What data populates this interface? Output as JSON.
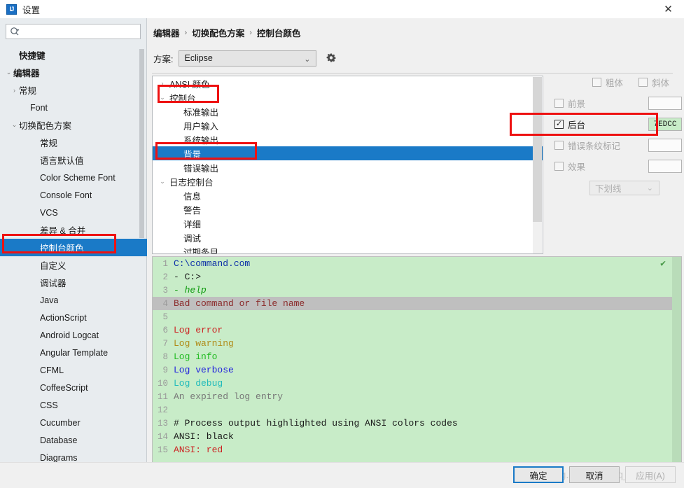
{
  "window": {
    "title": "设置",
    "app_icon_text": "IJ",
    "close_icon": "close-icon",
    "close_glyph": "✕"
  },
  "search": {
    "placeholder": "",
    "value": "",
    "icon": "search-icon"
  },
  "sidebar": {
    "items": [
      {
        "label": "快捷键",
        "indent": 1,
        "twist": "",
        "bold": true,
        "selected": false
      },
      {
        "label": "编辑器",
        "indent": 0,
        "twist": "⌄",
        "bold": true,
        "selected": false
      },
      {
        "label": "常规",
        "indent": 1,
        "twist": "›",
        "bold": false,
        "selected": false
      },
      {
        "label": "Font",
        "indent": 2,
        "twist": "",
        "bold": false,
        "selected": false
      },
      {
        "label": "切换配色方案",
        "indent": 1,
        "twist": "⌄",
        "bold": false,
        "selected": false
      },
      {
        "label": "常规",
        "indent": 3,
        "twist": "",
        "bold": false,
        "selected": false
      },
      {
        "label": "语言默认值",
        "indent": 3,
        "twist": "",
        "bold": false,
        "selected": false
      },
      {
        "label": "Color Scheme Font",
        "indent": 3,
        "twist": "",
        "bold": false,
        "selected": false
      },
      {
        "label": "Console Font",
        "indent": 3,
        "twist": "",
        "bold": false,
        "selected": false
      },
      {
        "label": "VCS",
        "indent": 3,
        "twist": "",
        "bold": false,
        "selected": false
      },
      {
        "label": "差异 & 合并",
        "indent": 3,
        "twist": "",
        "bold": false,
        "selected": false
      },
      {
        "label": "控制台颜色",
        "indent": 3,
        "twist": "",
        "bold": false,
        "selected": true
      },
      {
        "label": "自定义",
        "indent": 3,
        "twist": "",
        "bold": false,
        "selected": false
      },
      {
        "label": "调试器",
        "indent": 3,
        "twist": "",
        "bold": false,
        "selected": false
      },
      {
        "label": "Java",
        "indent": 3,
        "twist": "",
        "bold": false,
        "selected": false
      },
      {
        "label": "ActionScript",
        "indent": 3,
        "twist": "",
        "bold": false,
        "selected": false
      },
      {
        "label": "Android Logcat",
        "indent": 3,
        "twist": "",
        "bold": false,
        "selected": false
      },
      {
        "label": "Angular Template",
        "indent": 3,
        "twist": "",
        "bold": false,
        "selected": false
      },
      {
        "label": "CFML",
        "indent": 3,
        "twist": "",
        "bold": false,
        "selected": false
      },
      {
        "label": "CoffeeScript",
        "indent": 3,
        "twist": "",
        "bold": false,
        "selected": false
      },
      {
        "label": "CSS",
        "indent": 3,
        "twist": "",
        "bold": false,
        "selected": false
      },
      {
        "label": "Cucumber",
        "indent": 3,
        "twist": "",
        "bold": false,
        "selected": false
      },
      {
        "label": "Database",
        "indent": 3,
        "twist": "",
        "bold": false,
        "selected": false
      },
      {
        "label": "Diagrams",
        "indent": 3,
        "twist": "",
        "bold": false,
        "selected": false
      }
    ],
    "help_label": "?"
  },
  "breadcrumb": {
    "parts": [
      "编辑器",
      "切换配色方案",
      "控制台颜色"
    ],
    "separator": "›"
  },
  "scheme": {
    "label": "方案:",
    "value": "Eclipse",
    "chevron": "⌄",
    "gear_icon": "gear-icon"
  },
  "attributes": {
    "rows": [
      {
        "label": "ANSI 颜色",
        "twist": "›",
        "child": false,
        "selected": false
      },
      {
        "label": "控制台",
        "twist": "⌄",
        "child": false,
        "selected": false
      },
      {
        "label": "标准输出",
        "twist": "",
        "child": true,
        "selected": false
      },
      {
        "label": "用户输入",
        "twist": "",
        "child": true,
        "selected": false
      },
      {
        "label": "系统输出",
        "twist": "",
        "child": true,
        "selected": false
      },
      {
        "label": "背景",
        "twist": "",
        "child": true,
        "selected": true
      },
      {
        "label": "错误输出",
        "twist": "",
        "child": true,
        "selected": false
      },
      {
        "label": "日志控制台",
        "twist": "⌄",
        "child": false,
        "selected": false
      },
      {
        "label": "信息",
        "twist": "",
        "child": true,
        "selected": false
      },
      {
        "label": "警告",
        "twist": "",
        "child": true,
        "selected": false
      },
      {
        "label": "详细",
        "twist": "",
        "child": true,
        "selected": false
      },
      {
        "label": "调试",
        "twist": "",
        "child": true,
        "selected": false
      },
      {
        "label": "过期条目",
        "twist": "",
        "child": true,
        "selected": false
      }
    ]
  },
  "options": {
    "bold_label": "粗体",
    "bold_checked": false,
    "italic_label": "斜体",
    "italic_checked": false,
    "foreground_label": "前景",
    "foreground_checked": false,
    "foreground_value": "",
    "background_label": "后台",
    "background_checked": true,
    "background_value": "7EDCC",
    "background_color": "#c8ecc8",
    "error_stripe_label": "错误条纹标记",
    "error_stripe_checked": false,
    "error_stripe_value": "",
    "effect_label": "效果",
    "effect_checked": false,
    "effect_value": "",
    "effect_type": "下划线",
    "effect_chevron": "⌄",
    "checkmark": "✓"
  },
  "preview": {
    "background_color": "#c8ecc8",
    "inspect_icon": "inspection-check-icon",
    "inspect_glyph": "✔",
    "lines": [
      {
        "n": "1",
        "text": "C:\\command.com",
        "color": "#0b2ea8",
        "italic": false,
        "hl": false
      },
      {
        "n": "2",
        "text": "- C:>",
        "color": "#1a1a1a",
        "italic": false,
        "hl": false
      },
      {
        "n": "3",
        "text": "- help",
        "color": "#0f9b0f",
        "italic": true,
        "hl": false
      },
      {
        "n": "4",
        "text": "Bad command or file name",
        "color": "#8b2b2b",
        "italic": false,
        "hl": true
      },
      {
        "n": "5",
        "text": "",
        "color": "#1a1a1a",
        "italic": false,
        "hl": false
      },
      {
        "n": "6",
        "text": "Log error",
        "color": "#cc2222",
        "italic": false,
        "hl": false
      },
      {
        "n": "7",
        "text": "Log warning",
        "color": "#b08c1a",
        "italic": false,
        "hl": false
      },
      {
        "n": "8",
        "text": "Log info",
        "color": "#22bb22",
        "italic": false,
        "hl": false
      },
      {
        "n": "9",
        "text": "Log verbose",
        "color": "#2222dd",
        "italic": false,
        "hl": false
      },
      {
        "n": "10",
        "text": "Log debug",
        "color": "#22bbbb",
        "italic": false,
        "hl": false
      },
      {
        "n": "11",
        "text": "An expired log entry",
        "color": "#777777",
        "italic": false,
        "hl": false
      },
      {
        "n": "12",
        "text": "",
        "color": "#1a1a1a",
        "italic": false,
        "hl": false
      },
      {
        "n": "13",
        "text": "# Process output highlighted using ANSI colors codes",
        "color": "#1a1a1a",
        "italic": false,
        "hl": false
      },
      {
        "n": "14",
        "text": "ANSI: black",
        "color": "#1a1a1a",
        "italic": false,
        "hl": false
      },
      {
        "n": "15",
        "text": "ANSI: red",
        "color": "#cc2222",
        "italic": false,
        "hl": false
      }
    ]
  },
  "buttons": {
    "ok": "确定",
    "cancel": "取消",
    "apply": "应用(A)"
  },
  "watermark": {
    "text": "https://blog.csdn.net/qq_39960031"
  },
  "annotations": {
    "accent_red": "#ee1111",
    "selection_blue": "#1a7ac7"
  }
}
